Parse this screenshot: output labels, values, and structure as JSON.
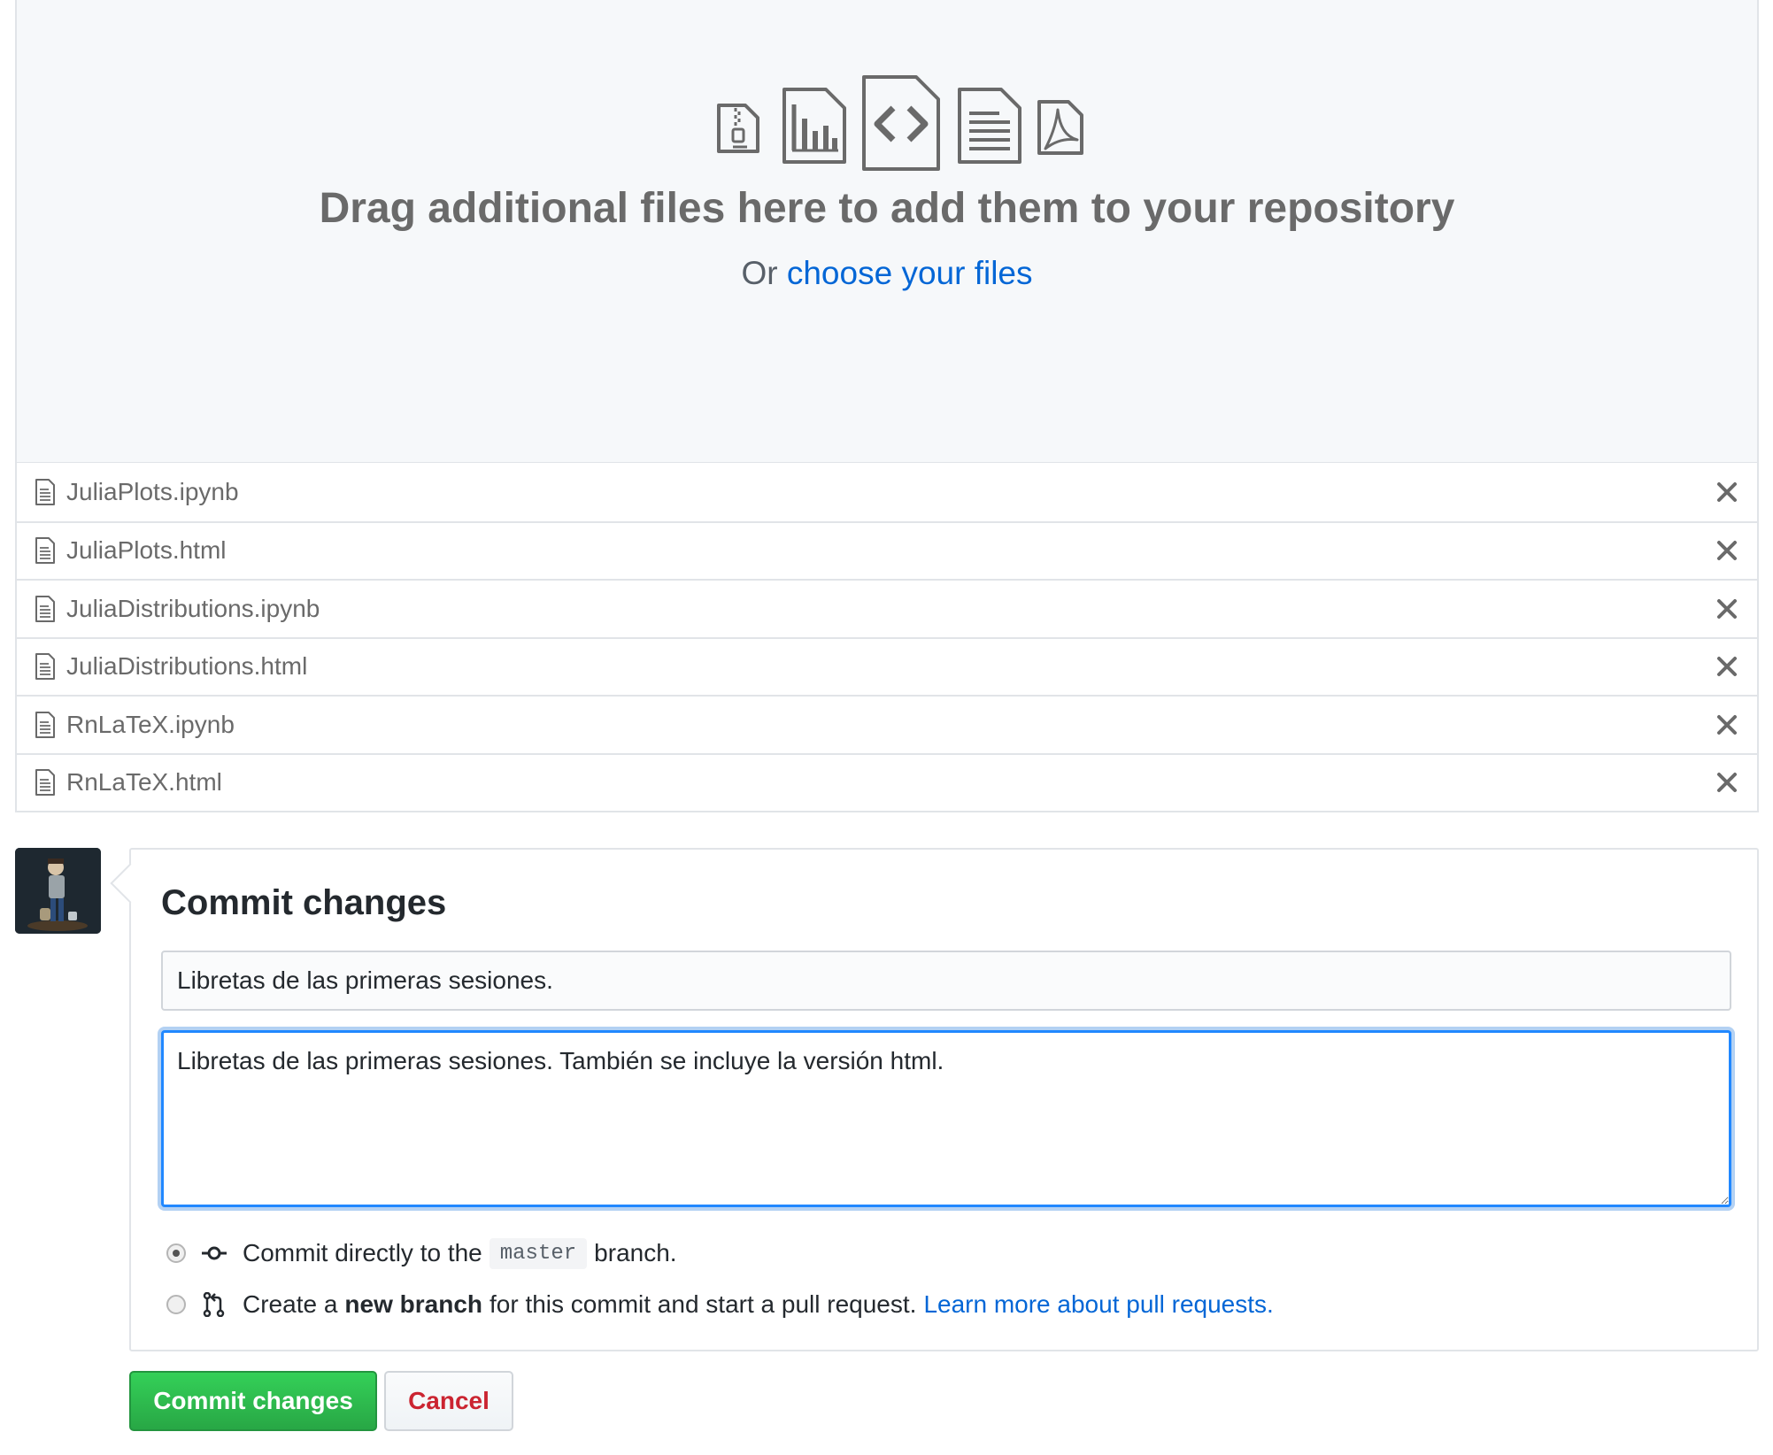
{
  "dropzone": {
    "icons": [
      "file-zip-icon",
      "graph-file-icon",
      "file-code-icon",
      "file-text-icon",
      "file-pdf-icon"
    ],
    "title": "Drag additional files here to add them to your repository",
    "or_text": "Or",
    "choose_link": "choose your files"
  },
  "files": [
    {
      "name": "JuliaPlots.ipynb"
    },
    {
      "name": "JuliaPlots.html"
    },
    {
      "name": "JuliaDistributions.ipynb"
    },
    {
      "name": "JuliaDistributions.html"
    },
    {
      "name": "RnLaTeX.ipynb"
    },
    {
      "name": "RnLaTeX.html"
    }
  ],
  "commit": {
    "title": "Commit changes",
    "summary_value": "Libretas de las primeras sesiones.",
    "description_value": "Libretas de las primeras sesiones. También se incluye la versión html.",
    "option_direct": {
      "before": "Commit directly to the",
      "branch": "master",
      "after": "branch."
    },
    "option_new": {
      "before": "Create a",
      "bold": "new branch",
      "after": "for this commit and start a pull request.",
      "link": "Learn more about pull requests."
    },
    "selected_option": "direct"
  },
  "buttons": {
    "commit_label": "Commit changes",
    "cancel_label": "Cancel"
  },
  "colors": {
    "link": "#0366d6",
    "commit_button": "#28a745",
    "cancel_text": "#cb2431",
    "focus_border": "#2188ff"
  }
}
